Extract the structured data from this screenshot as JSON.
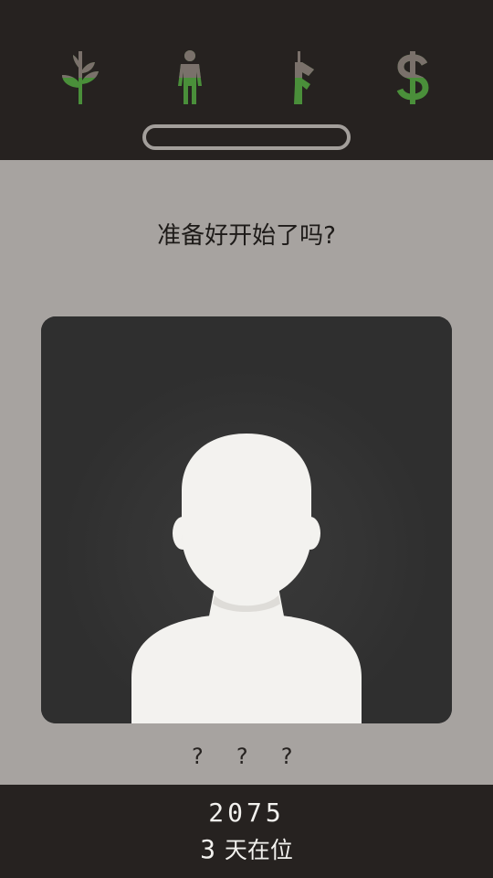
{
  "stats": [
    {
      "name": "religion",
      "icon": "plant-icon",
      "level": 0.5
    },
    {
      "name": "people",
      "icon": "person-icon",
      "level": 0.5
    },
    {
      "name": "military",
      "icon": "rifle-icon",
      "level": 0.5
    },
    {
      "name": "money",
      "icon": "dollar-icon",
      "level": 0.5
    }
  ],
  "progress": 0,
  "prompt": "准备好开始了吗?",
  "character": {
    "name": "? ? ?",
    "portrait": "silhouette-icon"
  },
  "footer": {
    "year": "2075",
    "days_count": "3",
    "days_label": "天在位"
  },
  "colors": {
    "top_bar": "#262220",
    "main_bg": "#a7a3a0",
    "card_bg": "#2f2f2f",
    "icon_gray": "#7a716b",
    "icon_green": "#4a8f3a",
    "silhouette": "#f3f2ef"
  }
}
